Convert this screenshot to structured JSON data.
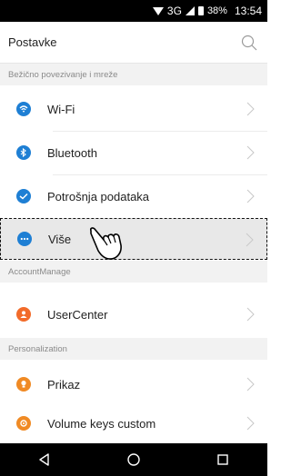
{
  "status_bar": {
    "network": "3G",
    "battery": "38%",
    "time": "13:54"
  },
  "header": {
    "title": "Postavke"
  },
  "sections": [
    {
      "label": "Bežično povezivanje i mreže"
    },
    {
      "label": "AccountManage"
    },
    {
      "label": "Personalization"
    }
  ],
  "items": [
    {
      "label": "Wi-Fi",
      "icon": "wifi-icon",
      "color": "#1e7fd4"
    },
    {
      "label": "Bluetooth",
      "icon": "bluetooth-icon",
      "color": "#1e7fd4"
    },
    {
      "label": "Potrošnja podataka",
      "icon": "data-usage-icon",
      "color": "#1e7fd4"
    },
    {
      "label": "Više",
      "icon": "more-icon",
      "color": "#1e7fd4"
    },
    {
      "label": "UserCenter",
      "icon": "user-icon",
      "color": "#f26b2a"
    },
    {
      "label": "Prikaz",
      "icon": "display-icon",
      "color": "#f08a24"
    },
    {
      "label": "Volume keys custom",
      "icon": "volume-icon",
      "color": "#f08a24"
    }
  ]
}
